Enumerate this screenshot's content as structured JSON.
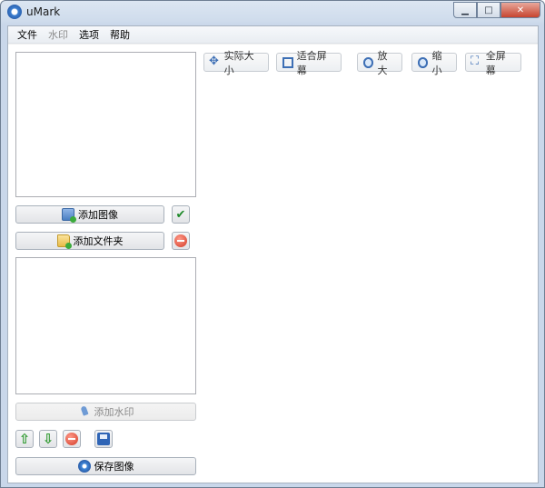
{
  "window": {
    "title": "uMark",
    "minimize_glyph": "▁",
    "maximize_glyph": "□",
    "close_glyph": "✕"
  },
  "menu": [
    {
      "label": "文件",
      "enabled": true
    },
    {
      "label": "水印",
      "enabled": false
    },
    {
      "label": "选项",
      "enabled": true
    },
    {
      "label": "帮助",
      "enabled": true
    }
  ],
  "left_panel": {
    "add_image_label": "添加图像",
    "add_folder_label": "添加文件夹",
    "add_watermark_label": "添加水印",
    "save_image_label": "保存图像"
  },
  "toolbar": {
    "actual_size_label": "实际大小",
    "fit_screen_label": "适合屏幕",
    "zoom_in_label": "放大",
    "zoom_out_label": "缩小",
    "full_screen_label": "全屏幕"
  },
  "colors": {
    "accent": "#3d6fb5",
    "confirm_green": "#1f8a2a",
    "remove_red": "#d33a25"
  }
}
